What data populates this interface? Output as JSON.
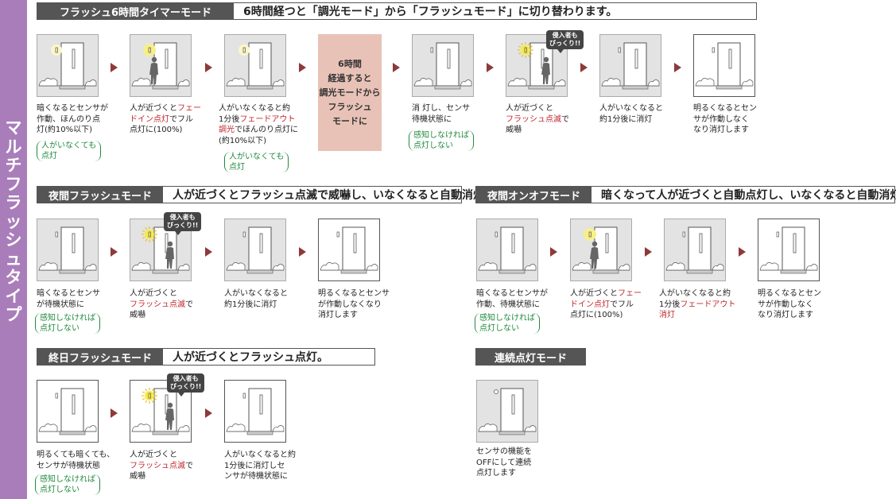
{
  "sidebar": {
    "title": "マルチフラッシュタイプ"
  },
  "sections": {
    "flash6": {
      "tag": "フラッシュ6時間タイマーモード",
      "desc": "6時間経つと「調光モード」から「フラッシュモード」に切り替わります。"
    },
    "night": {
      "tag": "夜間フラッシュモード",
      "desc": "人が近づくとフラッシュ点滅で威嚇し、いなくなると自動消灯。"
    },
    "onoff": {
      "tag": "夜間オンオフモード",
      "desc": "暗くなって人が近づくと自動点灯し、いなくなると自動消灯。"
    },
    "allday": {
      "tag": "終日フラッシュモード",
      "desc": "人が近づくとフラッシュ点灯。"
    },
    "cont": {
      "tag": "連続点灯モード",
      "desc": ""
    }
  },
  "transition_box": "6時間\n経過すると\n調光モードから\nフラッシュ\nモードに",
  "bubble_text": "侵入者も\nびっくり!!",
  "captions": {
    "f1": "暗くなるとセンサが\n作動、ほんのり点\n灯(約10%以下)",
    "f2a": "人が近づくと",
    "f2b": "フェー\nドイン点灯",
    "f2c": "でフル\n点灯に(100%)",
    "f3a": "人がいなくなると約\n1分後",
    "f3b": "フェードアウト\n調光",
    "f3c": "でほんのり点灯に\n(約10%以下)",
    "f5": "消 灯し、センサ\n待機状態に",
    "f6a": "人が近づくと\n",
    "f6b": "フラッシュ点滅",
    "f6c": "で\n威嚇",
    "f7": "人がいなくなると\n約1分後に消灯",
    "f8": "明るくなるとセン\nサが作動しなく\nなり消灯します",
    "n1": "暗くなるとセンサ\nが待機状態に",
    "n2a": "人が近づくと\n",
    "n2b": "フラッシュ点滅",
    "n2c": "で\n威嚇",
    "n3": "人がいなくなると\n約1分後に消灯",
    "n4": "明るくなるとセンサ\nが作動しなくなり\n消灯します",
    "o1": "暗くなるとセンサが\n作動、待機状態に",
    "o2a": "人が近づくと",
    "o2b": "フェー\nドイン点灯",
    "o2c": "でフル\n点灯に(100%)",
    "o3a": "人がいなくなると約\n1分後",
    "o3b": "フェードアウト\n消灯",
    "o4": "明るくなるとセン\nサが作動しなく\nなり消灯します",
    "a1": "明るくても暗くても、\nセンサが待機状態",
    "a2a": "人が近づくと\n",
    "a2b": "フラッシュ点滅",
    "a2c": "で\n威嚇",
    "a3": "人がいなくなると約\n1分後に消灯しセ\nンサが待機状態に",
    "c1": "センサの機能を\nOFFにして連続\n点灯します"
  },
  "notes": {
    "always_on": "人がいなくても\n点灯",
    "no_detect": "感知しなければ\n点灯しない"
  },
  "colors": {
    "accent": "#a97dba",
    "arrow": "#8e3a3a",
    "highlight": "#c0282e",
    "note": "#1f8a3c",
    "transition": "#e9c2b7"
  }
}
